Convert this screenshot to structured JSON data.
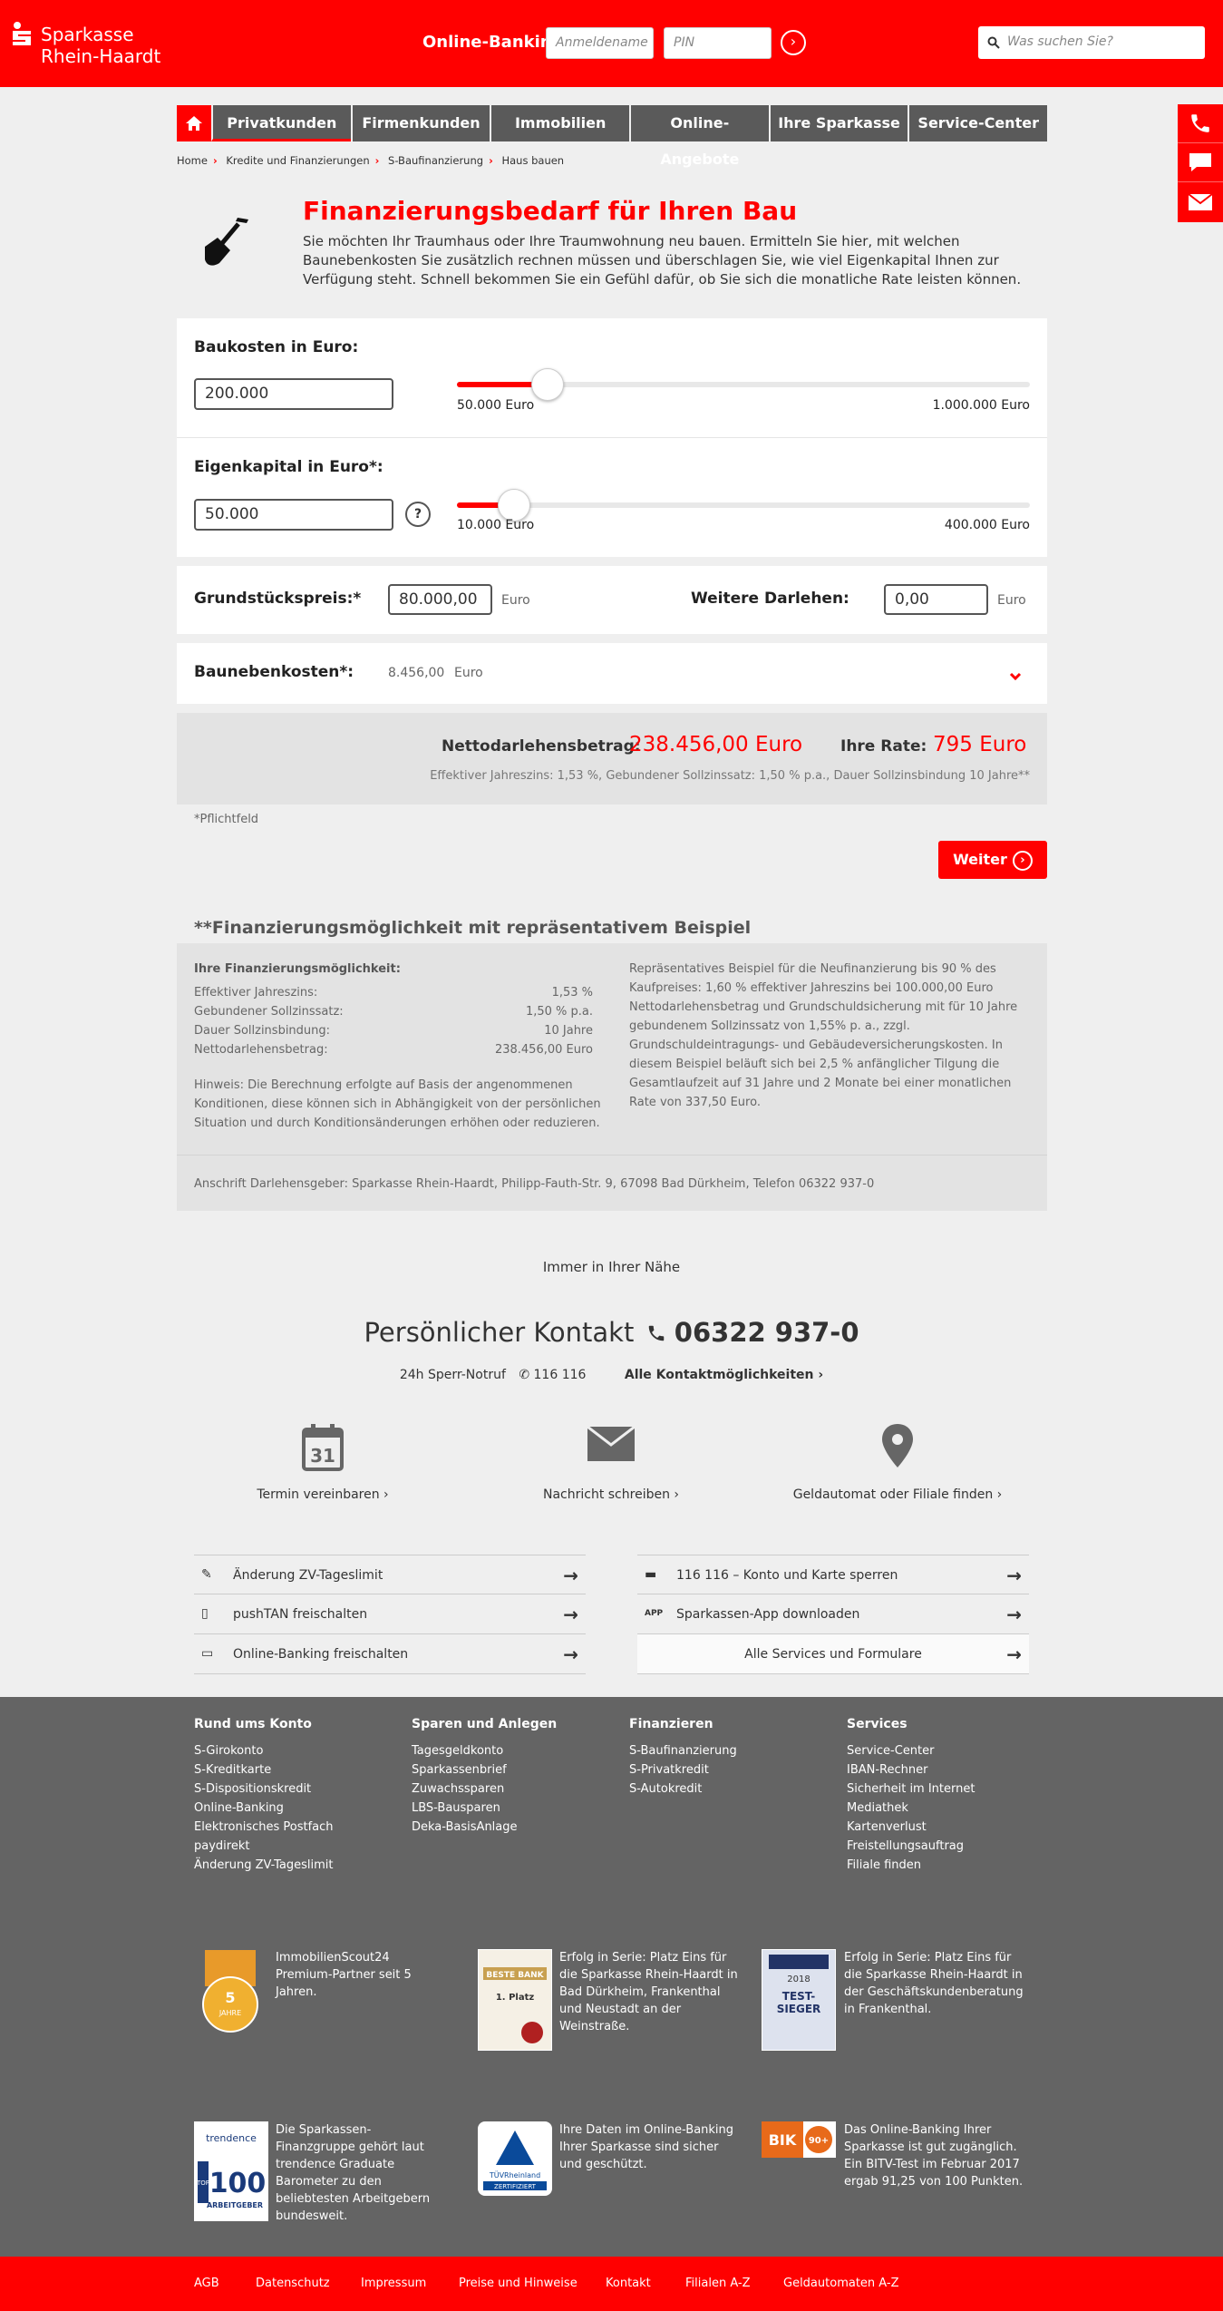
{
  "header": {
    "brand_line1": "Sparkasse",
    "brand_line2": "Rhein-Haardt",
    "online_banking_label": "Online-Banking",
    "username_placeholder": "Anmeldename",
    "pin_placeholder": "PIN",
    "search_placeholder": "Was suchen Sie?"
  },
  "nav": {
    "tabs": [
      "Privatkunden",
      "Firmenkunden",
      "Immobilien",
      "Online-Angebote",
      "Ihre Sparkasse",
      "Service-Center"
    ],
    "active": "Privatkunden"
  },
  "breadcrumb": [
    "Home",
    "Kredite und Finanzierungen",
    "S-Baufinanzierung",
    "Haus bauen"
  ],
  "page": {
    "title": "Finanzierungsbedarf für Ihren Bau",
    "intro": "Sie möchten Ihr Traumhaus oder Ihre Traumwohnung neu bauen. Ermitteln Sie hier, mit welchen Baunebenkosten Sie zusätzlich rechnen müssen und überschlagen Sie, wie viel Eigenkapital Ihnen zur Verfügung steht. Schnell bekommen Sie ein Gefühl dafür, ob Sie sich die monatliche Rate leisten können."
  },
  "calc": {
    "baukosten": {
      "label": "Baukosten in Euro:",
      "value": "200.000",
      "min_label": "50.000 Euro",
      "max_label": "1.000.000 Euro",
      "slider_fraction": 0.158
    },
    "eigenkapital": {
      "label": "Eigenkapital in Euro*:",
      "value": "50.000",
      "min_label": "10.000 Euro",
      "max_label": "400.000 Euro",
      "slider_fraction": 0.1,
      "help": "?"
    },
    "grundstueck": {
      "label": "Grundstückspreis:*",
      "value": "80.000,00",
      "unit": "Euro"
    },
    "weitere": {
      "label": "Weitere Darlehen:",
      "value": "0,00",
      "unit": "Euro"
    },
    "nebenkosten": {
      "label": "Baunebenkosten*:",
      "value": "8.456,00",
      "unit": "Euro"
    },
    "netto_label": "Nettodarlehensbetrag:",
    "netto_value": "238.456,00 Euro",
    "rate_label": "Ihre Rate:",
    "rate_value": "795 Euro",
    "zins_note": "Effektiver Jahreszins: 1,53 %, Gebundener Sollzinssatz: 1,50 % p.a., Dauer Sollzinsbindung 10 Jahre**",
    "pflicht": "*Pflichtfeld",
    "weiter": "Weiter"
  },
  "beispiel": {
    "title": "**Finanzierungsmöglichkeit mit repräsentativem Beispiel",
    "sub": "Ihre Finanzierungsmöglichkeit:",
    "rows": [
      {
        "k": "Effektiver Jahreszins:",
        "v": "1,53 %"
      },
      {
        "k": "Gebundener Sollzinssatz:",
        "v": "1,50 % p.a."
      },
      {
        "k": "Dauer Sollzinsbindung:",
        "v": "10 Jahre"
      },
      {
        "k": "Nettodarlehensbetrag:",
        "v": "238.456,00 Euro"
      }
    ],
    "hinweis": "Hinweis: Die Berechnung erfolgte auf Basis der angenommenen Konditionen, diese können sich in Abhängigkeit von der persönlichen Situation und durch Konditionsänderungen erhöhen oder reduzieren.",
    "rep_text": "Repräsentatives Beispiel für die Neufinanzierung bis 90 % des Kaufpreises: 1,60 % effektiver Jahreszins bei 100.000,00 Euro Nettodarlehensbetrag und Grundschuldsicherung mit für 10 Jahre gebundenem Sollzinssatz von 1,55% p. a., zzgl. Grundschuldeintragungs- und Gebäudeversicherungskosten. In diesem Beispiel beläuft sich bei 2,5 % anfänglicher Tilgung die Gesamtlaufzeit auf 31 Jahre und 2 Monate bei einer monatlichen Rate von 337,50 Euro.",
    "anschrift": "Anschrift Darlehensgeber: Sparkasse Rhein-Haardt, Philipp-Fauth-Str. 9, 67098 Bad Dürkheim, Telefon 06322 937-0"
  },
  "contact": {
    "near": "Immer in Ihrer Nähe",
    "title": "Persönlicher Kontakt",
    "phone": "06322 937-0",
    "sperr_label": "24h Sperr-Notruf",
    "sperr_number": "116 116",
    "all_link": "Alle Kontaktmöglichkeiten",
    "calendar_day": "31",
    "termin": "Termin vereinbaren",
    "nachricht": "Nachricht schreiben",
    "filiale": "Geldautomat oder Filiale finden",
    "links_left": [
      "Änderung ZV-Tageslimit",
      "pushTAN freischalten",
      "Online-Banking freischalten"
    ],
    "links_right": [
      "116 116 – Konto und Karte sperren",
      "Sparkassen-App downloaden",
      "Alle Services und Formulare"
    ],
    "app_badge": "APP"
  },
  "footer": {
    "cols": [
      {
        "title": "Rund ums Konto",
        "items": [
          "S-Girokonto",
          "S-Kreditkarte",
          "S-Dispositionskredit",
          "Online-Banking",
          "Elektronisches Postfach",
          "paydirekt",
          "Änderung ZV-Tageslimit"
        ]
      },
      {
        "title": "Sparen und Anlegen",
        "items": [
          "Tagesgeldkonto",
          "Sparkassenbrief",
          "Zuwachssparen",
          "LBS-Bausparen",
          "Deka-BasisAnlage"
        ]
      },
      {
        "title": "Finanzieren",
        "items": [
          "S-Baufinanzierung",
          "S-Privatkredit",
          "S-Autokredit"
        ]
      },
      {
        "title": "Services",
        "items": [
          "Service-Center",
          "IBAN-Rechner",
          "Sicherheit im Internet",
          "Mediathek",
          "Kartenverlust",
          "Freistellungsauftrag",
          "Filiale finden"
        ]
      }
    ],
    "awards": [
      "ImmobilienScout24 Premium-Partner seit 5 Jahren.",
      "Erfolg in Serie: Platz Eins für die Sparkasse Rhein-Haardt in Bad Dürkheim, Frankenthal und Neustadt an der Weinstraße.",
      "Erfolg in Serie: Platz Eins für die Sparkasse Rhein-Haardt in der Geschäftskundenberatung in Frankenthal.",
      "Die Sparkassen-Finanzgruppe gehört laut trendence Graduate Barometer zu den beliebtesten Arbeitgebern bundesweit.",
      "Ihre Daten im Online-Banking Ihrer Sparkasse sind sicher und geschützt.",
      "Das Online-Banking Ihrer Sparkasse ist gut zugänglich. Ein BITV-Test im Februar 2017 ergab 91,25 von 100 Punkten."
    ],
    "badges": {
      "scout_years": "5",
      "scout_word": "JAHRE",
      "beste_bank": "BESTE BANK",
      "platz": "1. Platz",
      "year": "2018",
      "test": "TEST-",
      "sieger": "SIEGER",
      "trendence": "trendence",
      "top": "TOP",
      "hundred": "100",
      "arbeitgeber": "ARBEITGEBER",
      "tuev": "TÜVRheinland",
      "zert": "ZERTIFIZIERT",
      "bik": "BIK",
      "bik_score": "90+"
    },
    "bottom_links": [
      "AGB",
      "Datenschutz",
      "Impressum",
      "Preise und Hinweise",
      "Kontakt",
      "Filialen A-Z",
      "Geldautomaten A-Z"
    ]
  },
  "colors": {
    "brand": "#ff0000",
    "nav": "#5a5a5a",
    "footer": "#646464"
  }
}
